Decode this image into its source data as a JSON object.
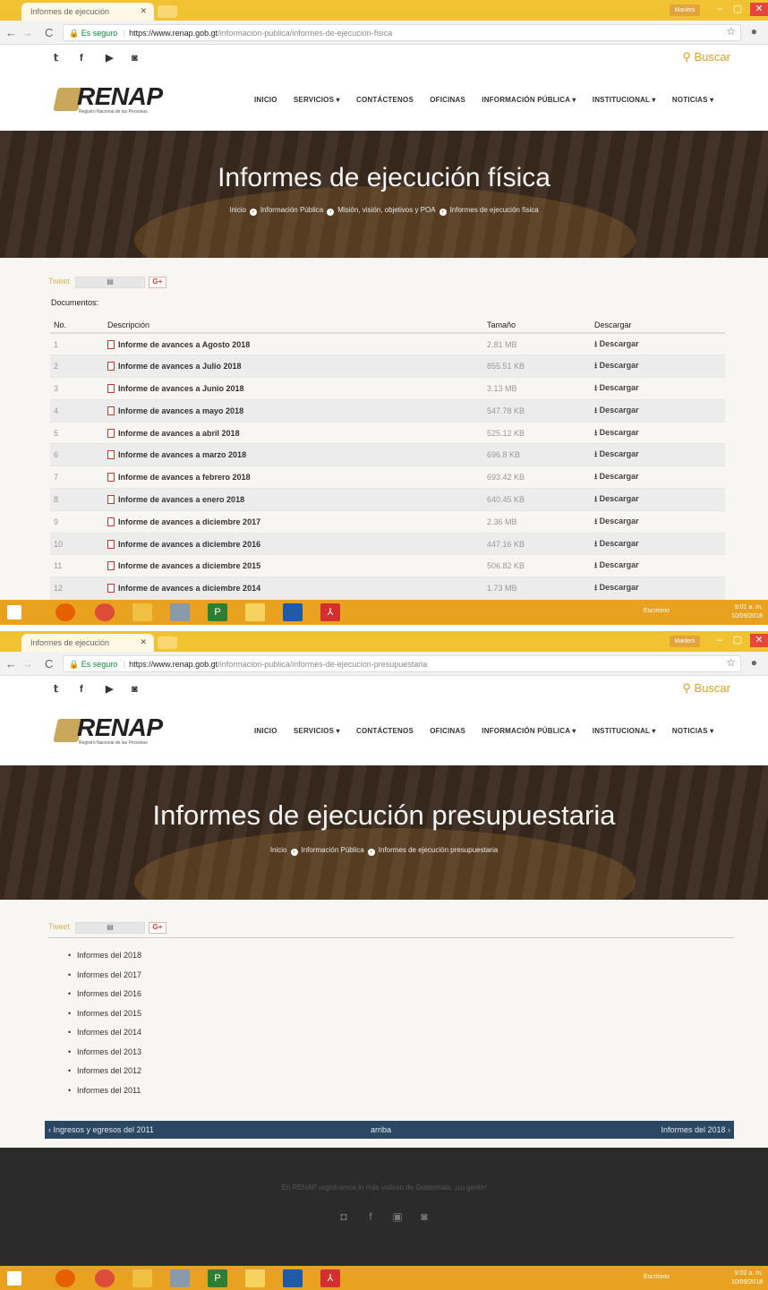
{
  "screen1": {
    "tab_title": "Informes de ejecución",
    "url_secure": "Es seguro",
    "url_host": "https://www.renap.gob.gt",
    "url_path": "/informacion-publica/informes-de-ejecucion-fisica",
    "hero_title": "Informes de ejecución física",
    "breadcrumbs": [
      "Inicio",
      "Información Pública",
      "Misión, visión, objetivos y POA",
      "Informes de ejecución física"
    ],
    "docs_label": "Documentos:",
    "columns": [
      "No.",
      "Descripción",
      "Tamaño",
      "Descargar"
    ],
    "rows": [
      {
        "no": "1",
        "desc": "Informe de avances a Agosto 2018",
        "size": "2.81 MB",
        "dl": "Descargar"
      },
      {
        "no": "2",
        "desc": "Informe de avances a Julio 2018",
        "size": "855.51 KB",
        "dl": "Descargar"
      },
      {
        "no": "3",
        "desc": "Informe de avances a Junio 2018",
        "size": "3.13 MB",
        "dl": "Descargar"
      },
      {
        "no": "4",
        "desc": "Informe de avances a mayo 2018",
        "size": "547.78 KB",
        "dl": "Descargar"
      },
      {
        "no": "5",
        "desc": "Informe de avances a abril 2018",
        "size": "525.12 KB",
        "dl": "Descargar"
      },
      {
        "no": "6",
        "desc": "Informe de avances a marzo 2018",
        "size": "696.8 KB",
        "dl": "Descargar"
      },
      {
        "no": "7",
        "desc": "Informe de avances a febrero 2018",
        "size": "693.42 KB",
        "dl": "Descargar"
      },
      {
        "no": "8",
        "desc": "Informe de avances a enero 2018",
        "size": "640.45 KB",
        "dl": "Descargar"
      },
      {
        "no": "9",
        "desc": "Informe de avances a diciembre 2017",
        "size": "2.36 MB",
        "dl": "Descargar"
      },
      {
        "no": "10",
        "desc": "Informe de avances a diciembre 2016",
        "size": "447.16 KB",
        "dl": "Descargar"
      },
      {
        "no": "11",
        "desc": "Informe de avances a diciembre 2015",
        "size": "506.82 KB",
        "dl": "Descargar"
      },
      {
        "no": "12",
        "desc": "Informe de avances a diciembre 2014",
        "size": "1.73 MB",
        "dl": "Descargar"
      }
    ],
    "clock_time": "9:01 a. m.",
    "clock_date": "10/09/2018"
  },
  "screen2": {
    "tab_title": "Informes de ejecución",
    "url_secure": "Es seguro",
    "url_host": "https://www.renap.gob.gt",
    "url_path": "/informacion-publica/informes-de-ejecucion-presupuestaria",
    "hero_title": "Informes de ejecución presupuestaria",
    "breadcrumbs": [
      "Inicio",
      "Información Pública",
      "Informes de ejecución presupuestaria"
    ],
    "years": [
      "Informes del 2018",
      "Informes del 2017",
      "Informes del 2016",
      "Informes del 2015",
      "Informes del 2014",
      "Informes del 2013",
      "Informes del 2012",
      "Informes del 2011"
    ],
    "pager_prev": "‹ Ingresos y egresos del 2011",
    "pager_up": "arriba",
    "pager_next": "Informes del 2018 ›",
    "footer_text": "En RENAP registramos lo más valioso de Guatemala, ¡su gente!",
    "clock_time": "9:02 a. m.",
    "clock_date": "10/09/2018"
  },
  "site": {
    "logo_text": "RENAP",
    "logo_sub": "Registro Nacional de las Personas",
    "search_label": "Buscar",
    "menu": [
      "INICIO",
      "SERVICIOS ▾",
      "CONTÁCTENOS",
      "OFICINAS",
      "INFORMACIÓN PÚBLICA ▾",
      "INSTITUCIONAL ▾",
      "NOTICIAS ▾"
    ],
    "tweet_label": "Tweet",
    "gplus_label": "G+",
    "user_label": "Marleni",
    "desktop_label": "Escritorio"
  },
  "colors": {
    "accent": "#e8a21f",
    "hero_bg": "#3b2a1e",
    "pager_bg": "#2b4764",
    "footer_bg": "#2b2b2b"
  }
}
